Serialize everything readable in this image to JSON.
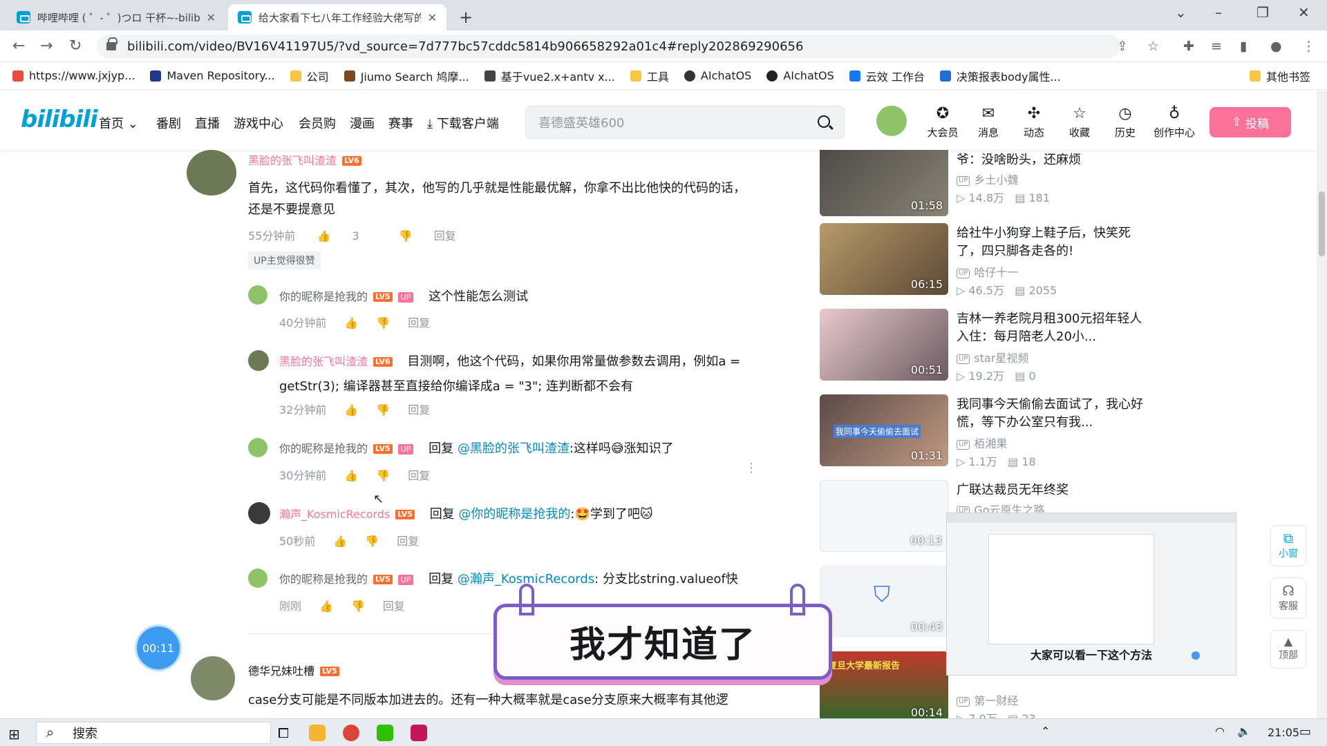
{
  "browser": {
    "tabs": [
      {
        "title": "哔哩哔哩 ( ゜- ゜)つロ 干杯~-bilibili"
      },
      {
        "title": "给大家看下七八年工作经验大佬写的代码"
      }
    ],
    "new_tab": "+",
    "url": "bilibili.com/video/BV16V41197U5/?vd_source=7d777bc57cddc5814b906658292a01c4#reply202869290656",
    "bookmarks": [
      "https://www.jxjyp...",
      "Maven Repository...",
      "公司",
      "Jiumo Search 鸠摩...",
      "基于vue2.x+antv x...",
      "工具",
      "AIchatOS",
      "AIchatOS",
      "云效 工作台",
      "决策报表body属性..."
    ],
    "other_bookmarks": "其他书签"
  },
  "header": {
    "logo": "bilibili",
    "nav": [
      "首页",
      "番剧",
      "直播",
      "游戏中心",
      "会员购",
      "漫画",
      "赛事",
      "下载客户端"
    ],
    "search_placeholder": "喜德盛英雄600",
    "actions": [
      "大会员",
      "消息",
      "动态",
      "收藏",
      "历史",
      "创作中心"
    ],
    "upload": "投稿"
  },
  "comments": {
    "main": {
      "user": "黑脸的张飞叫渣渣",
      "level": "LV6",
      "text_line1": "首先，这代码你看懂了，其次，他写的几乎就是性能最优解，你拿不出比他快的代码的话，",
      "text_line2": "还是不要提意见",
      "time": "55分钟前",
      "likes": "3",
      "reply": "回复",
      "tag": "UP主觉得很赞"
    },
    "replies": [
      {
        "user": "你的昵称是抢我的",
        "level": "LV5",
        "up": "UP",
        "text": "这个性能怎么测试",
        "time": "40分钟前",
        "reply": "回复"
      },
      {
        "user": "黑脸的张飞叫渣渣",
        "level": "LV6",
        "text": "目测啊，他这个代码，如果你用常量做参数去调用，例如a =",
        "text2": "getStr(3); 编译器甚至直接给你编译成a = \"3\"; 连判断都不会有",
        "time": "32分钟前",
        "reply": "回复"
      },
      {
        "user": "你的昵称是抢我的",
        "level": "LV5",
        "up": "UP",
        "prefix": "回复",
        "mention": "@黑脸的张飞叫渣渣",
        "text": ":这样吗😅涨知识了",
        "time": "30分钟前",
        "reply": "回复"
      },
      {
        "user": "瀚声_KosmicRecords",
        "level": "LV5",
        "prefix": "回复",
        "mention": "@你的昵称是抢我的",
        "text": ":🤩学到了吧🐱",
        "time": "50秒前",
        "reply": "回复"
      },
      {
        "user": "你的昵称是抢我的",
        "level": "LV5",
        "up": "UP",
        "prefix": "回复",
        "mention": "@瀚声_KosmicRecords",
        "text": ": 分支比string.valueof快",
        "time": "刚刚",
        "reply": "回复"
      }
    ],
    "next": {
      "user": "德华兄妹吐槽",
      "level": "LV5",
      "text": "case分支可能是不同版本加进去的。还有一种大概率就是case分支原来大概率有其他逻"
    }
  },
  "recommendations": [
    {
      "title": "爷：没啥盼头，还麻烦",
      "author": "乡土小魏",
      "views": "14.8万",
      "comments": "181",
      "duration": "01:58"
    },
    {
      "title": "给社牛小狗穿上鞋子后，快笑死了，四只脚各走各的!",
      "author": "哈仔十一",
      "views": "46.5万",
      "comments": "2055",
      "duration": "06:15"
    },
    {
      "title": "吉林一养老院月租300元招年轻人入住：每月陪老人20小...",
      "author": "star星视频",
      "views": "19.2万",
      "comments": "0",
      "duration": "00:51"
    },
    {
      "title": "我同事今天偷偷去面试了，我心好慌，等下办公室只有我...",
      "author": "栢湘果",
      "views": "1.1万",
      "comments": "18",
      "duration": "01:31",
      "overlay": "我同事今天偷偷去面试"
    },
    {
      "title": "广联达裁员无年终奖",
      "author": "Go云原生之路",
      "duration": "00:13"
    },
    {
      "title": "",
      "author": "",
      "duration": "00:43"
    },
    {
      "title": "",
      "author": "第一财经",
      "views": "7.0万",
      "comments": "23",
      "duration": "00:14",
      "overlay": "复旦大学最新报告"
    }
  ],
  "dock": {
    "mini": "小窗",
    "service": "客服",
    "top": "顶部"
  },
  "overlays": {
    "timer": "00:11",
    "sticker": "我才知道了",
    "pip_subtitle": "大家可以看一下这个方法"
  },
  "taskbar": {
    "search": "搜索",
    "clock": "21:05"
  }
}
